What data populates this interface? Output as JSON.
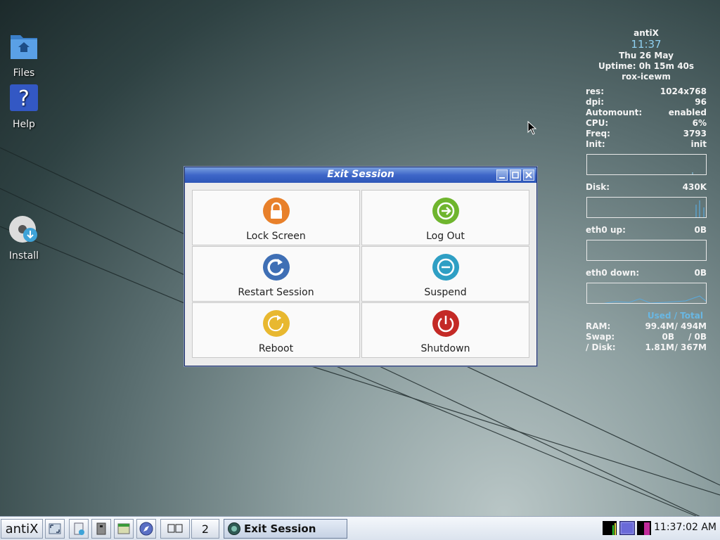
{
  "desktop": {
    "icons": [
      {
        "label": "Files",
        "icon": "folder-home-icon"
      },
      {
        "label": "Help",
        "icon": "help-icon"
      },
      {
        "label": "Install",
        "icon": "install-disc-icon"
      }
    ]
  },
  "conky": {
    "hostname": "antiX",
    "time": "11:37",
    "date": "Thu 26 May",
    "uptime": "Uptime: 0h 15m 40s",
    "wm": "rox-icewm",
    "stats": [
      {
        "key": "res:",
        "value": "1024x768"
      },
      {
        "key": "dpi:",
        "value": "96"
      },
      {
        "key": "Automount:",
        "value": "enabled"
      },
      {
        "key": "CPU:",
        "value": "6%"
      },
      {
        "key": "Freq:",
        "value": "3793"
      },
      {
        "key": "Init:",
        "value": "init"
      }
    ],
    "disk": {
      "key": "Disk:",
      "value": "430K"
    },
    "eth_up": {
      "key": "eth0 up:",
      "value": "0B"
    },
    "eth_down": {
      "key": "eth0 down:",
      "value": "0B"
    },
    "used_total": "Used / Total",
    "memory": [
      {
        "key": "RAM:",
        "used": "99.4M",
        "total": "/ 494M"
      },
      {
        "key": "Swap:",
        "used": "0B",
        "total": "/ 0B"
      },
      {
        "key": "/ Disk:",
        "used": "1.81M",
        "total": "/ 367M"
      }
    ],
    "accent": "#69b7e3"
  },
  "dialog": {
    "title": "Exit Session",
    "buttons": [
      {
        "label": "Lock Screen",
        "icon": "lock-icon",
        "color": "#e8802a"
      },
      {
        "label": "Log Out",
        "icon": "logout-arrow-icon",
        "color": "#6fb52e"
      },
      {
        "label": "Restart Session",
        "icon": "restart-icon",
        "color": "#3f6fb5"
      },
      {
        "label": "Suspend",
        "icon": "suspend-icon",
        "color": "#2f9fc4"
      },
      {
        "label": "Reboot",
        "icon": "reboot-icon",
        "color": "#e8b830"
      },
      {
        "label": "Shutdown",
        "icon": "power-icon",
        "color": "#c42a26"
      }
    ]
  },
  "taskbar": {
    "start_label": "antiX",
    "workspace_number": "2",
    "task_label": "Exit Session",
    "clock": "11:37:02 AM"
  }
}
